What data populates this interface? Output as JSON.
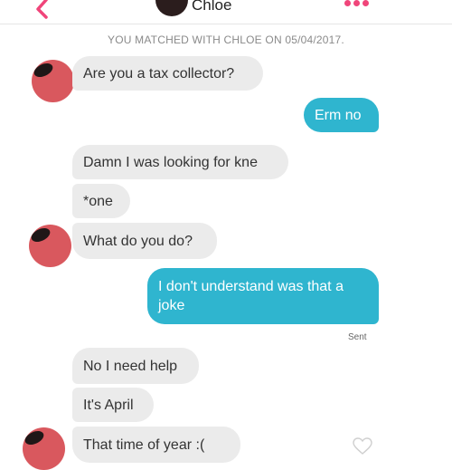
{
  "header": {
    "title": "Chloe"
  },
  "banner": {
    "text": "YOU MATCHED WITH CHLOE ON 05/04/2017."
  },
  "messages": [
    {
      "text": "Are you a tax collector?"
    },
    {
      "text": "Erm no"
    },
    {
      "text": "Damn I was looking for kne"
    },
    {
      "text": "*one"
    },
    {
      "text": "What do you do?"
    },
    {
      "text": "I don't understand was that a joke"
    },
    {
      "text": "No I need help"
    },
    {
      "text": "It's April"
    },
    {
      "text": "That time of year :("
    }
  ],
  "status": {
    "sent": "Sent"
  },
  "colors": {
    "sent_bubble": "#2fb5cf",
    "received_bubble": "#ebebeb",
    "accent": "#f0457a",
    "avatar": "#d9585e"
  },
  "icons": {
    "back": "chevron-left-icon",
    "menu": "more-dots-icon",
    "like": "heart-icon"
  }
}
